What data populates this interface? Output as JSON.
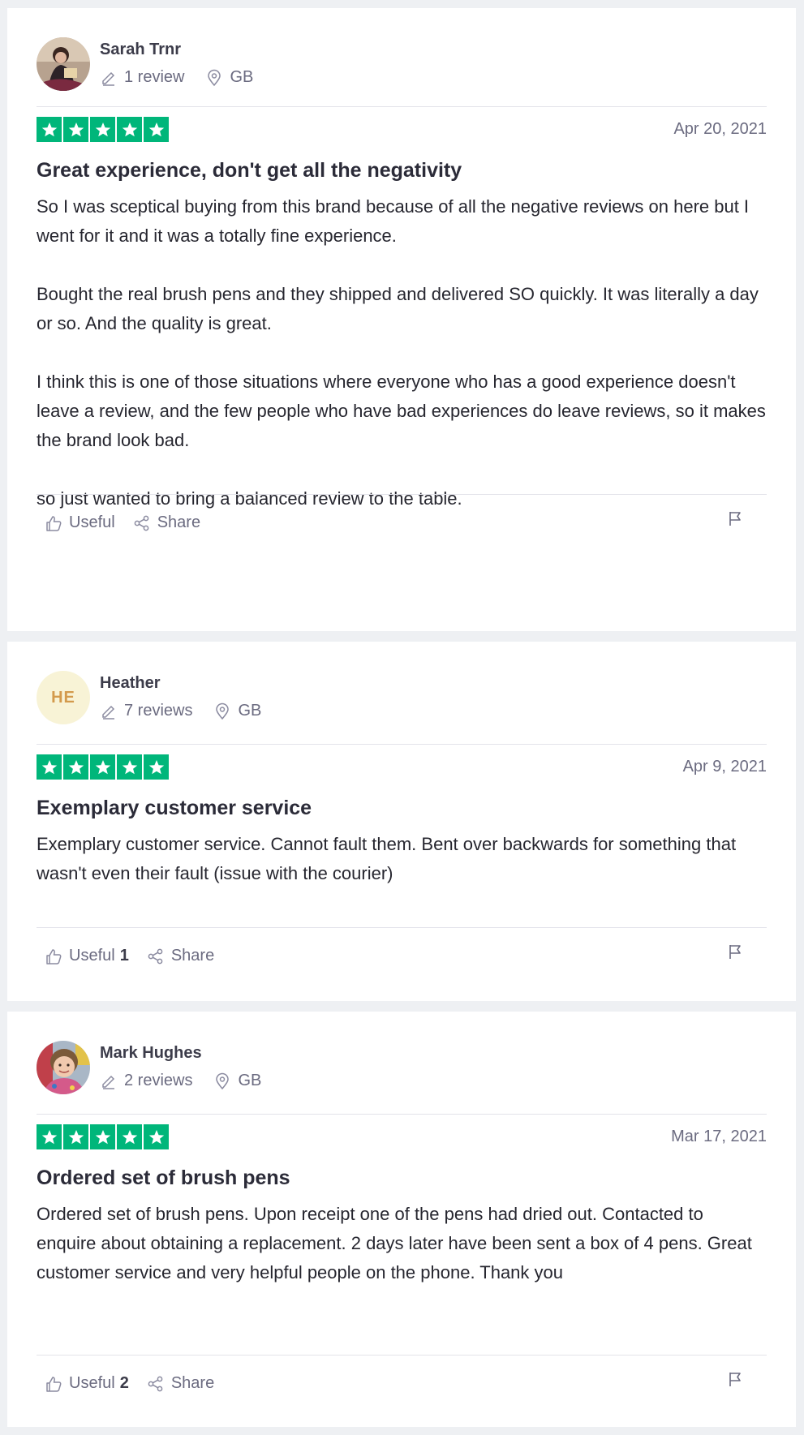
{
  "reviews": [
    {
      "name": "Sarah Trnr",
      "avatar_type": "photo",
      "review_count": "1 review",
      "country": "GB",
      "rating": 5,
      "date": "Apr 20, 2021",
      "title": "Great experience, don't get all the negativity",
      "paragraphs": [
        "So I was sceptical buying from this brand because of all the negative reviews on here but I went for it and it was a totally fine experience.",
        "Bought the real brush pens and they shipped and delivered SO quickly. It was literally a day or so. And the quality is great.",
        "I think this is one of those situations where everyone who has a good experience doesn't leave a review, and the few people who have bad experiences do leave reviews, so it makes the brand look bad.",
        "so just wanted to bring a balanced review to the table."
      ],
      "useful_label": "Useful",
      "useful_count": "",
      "share_label": "Share"
    },
    {
      "name": "Heather",
      "avatar_type": "initials",
      "initials": "HE",
      "review_count": "7 reviews",
      "country": "GB",
      "rating": 5,
      "date": "Apr 9, 2021",
      "title": "Exemplary customer service",
      "paragraphs": [
        "Exemplary customer service. Cannot fault them. Bent over backwards for something that wasn't even their fault (issue with the courier)"
      ],
      "useful_label": "Useful",
      "useful_count": "1",
      "share_label": "Share"
    },
    {
      "name": "Mark Hughes",
      "avatar_type": "photo",
      "review_count": "2 reviews",
      "country": "GB",
      "rating": 5,
      "date": "Mar 17, 2021",
      "title": "Ordered set of brush pens",
      "paragraphs": [
        "Ordered set of brush pens. Upon receipt one of the pens had dried out. Contacted to enquire about obtaining a replacement. 2 days later have been sent a box of 4 pens. Great customer service and very helpful people on the phone. Thank you"
      ],
      "useful_label": "Useful",
      "useful_count": "2",
      "share_label": "Share"
    }
  ],
  "colors": {
    "star_bg": "#00b67a",
    "muted_text": "#6b6b80",
    "initials_bg": "#f8f3d6",
    "initials_text": "#d39a4c"
  },
  "icons": {
    "pencil": "pencil-icon",
    "location": "location-pin-icon",
    "star": "star-icon",
    "thumbs_up": "thumbs-up-icon",
    "share": "share-icon",
    "flag": "flag-icon"
  }
}
